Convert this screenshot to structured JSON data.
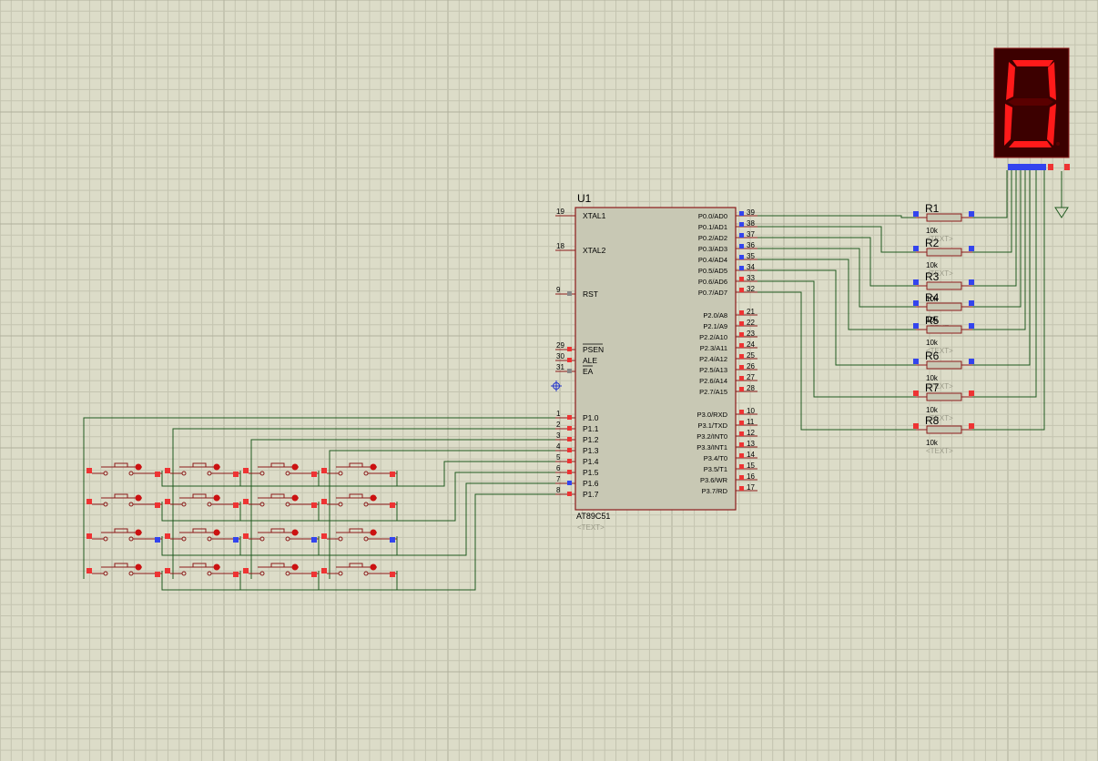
{
  "mcu": {
    "ref": "U1",
    "part": "AT89C51",
    "text_placeholder": "<TEXT>",
    "left_pins": [
      {
        "num": "19",
        "name": "XTAL1"
      },
      {
        "num": "18",
        "name": "XTAL2"
      },
      {
        "num": "9",
        "name": "RST"
      },
      {
        "num": "29",
        "name": "PSEN"
      },
      {
        "num": "30",
        "name": "ALE"
      },
      {
        "num": "31",
        "name": "EA"
      },
      {
        "num": "1",
        "name": "P1.0"
      },
      {
        "num": "2",
        "name": "P1.1"
      },
      {
        "num": "3",
        "name": "P1.2"
      },
      {
        "num": "4",
        "name": "P1.3"
      },
      {
        "num": "5",
        "name": "P1.4"
      },
      {
        "num": "6",
        "name": "P1.5"
      },
      {
        "num": "7",
        "name": "P1.6"
      },
      {
        "num": "8",
        "name": "P1.7"
      }
    ],
    "right_pins": [
      {
        "num": "39",
        "name": "P0.0/AD0"
      },
      {
        "num": "38",
        "name": "P0.1/AD1"
      },
      {
        "num": "37",
        "name": "P0.2/AD2"
      },
      {
        "num": "36",
        "name": "P0.3/AD3"
      },
      {
        "num": "35",
        "name": "P0.4/AD4"
      },
      {
        "num": "34",
        "name": "P0.5/AD5"
      },
      {
        "num": "33",
        "name": "P0.6/AD6"
      },
      {
        "num": "32",
        "name": "P0.7/AD7"
      },
      {
        "num": "21",
        "name": "P2.0/A8"
      },
      {
        "num": "22",
        "name": "P2.1/A9"
      },
      {
        "num": "23",
        "name": "P2.2/A10"
      },
      {
        "num": "24",
        "name": "P2.3/A11"
      },
      {
        "num": "25",
        "name": "P2.4/A12"
      },
      {
        "num": "26",
        "name": "P2.5/A13"
      },
      {
        "num": "27",
        "name": "P2.6/A14"
      },
      {
        "num": "28",
        "name": "P2.7/A15"
      },
      {
        "num": "10",
        "name": "P3.0/RXD"
      },
      {
        "num": "11",
        "name": "P3.1/TXD"
      },
      {
        "num": "12",
        "name": "P3.2/INT0"
      },
      {
        "num": "13",
        "name": "P3.3/INT1"
      },
      {
        "num": "14",
        "name": "P3.4/T0"
      },
      {
        "num": "15",
        "name": "P3.5/T1"
      },
      {
        "num": "16",
        "name": "P3.6/WR"
      },
      {
        "num": "17",
        "name": "P3.7/RD"
      }
    ]
  },
  "resistors": [
    {
      "ref": "R1",
      "value": "10k",
      "text": "<TEXT>"
    },
    {
      "ref": "R2",
      "value": "10k",
      "text": "<TEXT>"
    },
    {
      "ref": "R3",
      "value": "10k",
      "text": "<TEXT>"
    },
    {
      "ref": "R4",
      "value": "10k",
      "text": "<TEXT>"
    },
    {
      "ref": "R5",
      "value": "10k",
      "text": "<TEXT>"
    },
    {
      "ref": "R6",
      "value": "10k",
      "text": "<TEXT>"
    },
    {
      "ref": "R7",
      "value": "10k",
      "text": "<TEXT>"
    },
    {
      "ref": "R8",
      "value": "10k",
      "text": "<TEXT>"
    }
  ],
  "display": {
    "digit": "0"
  },
  "keypad": {
    "rows": 4,
    "cols": 4
  },
  "colors": {
    "background": "#dcdcc8",
    "grid": "#c4c4b0",
    "grid_major": "#b0b09c",
    "wire": "#1f5a1f",
    "component": "#8b1a1a",
    "chip_fill": "#c8c8b4",
    "pin_red": "#ee3333",
    "pin_blue": "#3344ee",
    "seg_on": "#ff1a1a",
    "seg_off": "#5a0000",
    "display_bg": "#3c0000"
  }
}
